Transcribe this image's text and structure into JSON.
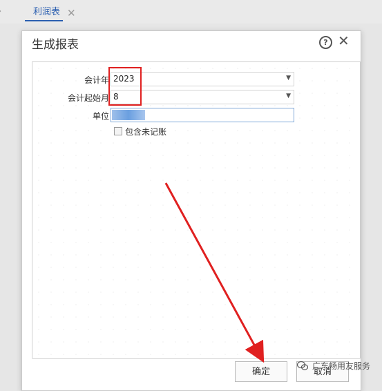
{
  "tab": {
    "label": "利润表",
    "close_symbol": "✕",
    "nav_symbol": "›"
  },
  "dialog": {
    "title": "生成报表",
    "help_symbol": "?",
    "close_symbol": "✕"
  },
  "form": {
    "fiscal_year_label": "会计年",
    "fiscal_year_value": "2023",
    "start_month_label": "会计起始月",
    "start_month_value": "8",
    "unit_label": "单位",
    "include_unposted_label": "包含未记账",
    "include_unposted_checked": false
  },
  "buttons": {
    "confirm_label": "确定",
    "cancel_label": "取消"
  },
  "watermark": {
    "text": "广东畅用友服务"
  },
  "colors": {
    "annotation_red": "#e02020",
    "tab_accent": "#2b5fb0"
  },
  "icons": {
    "help": "question-circle-icon",
    "close": "close-icon",
    "dropdown": "chevron-down-icon"
  }
}
